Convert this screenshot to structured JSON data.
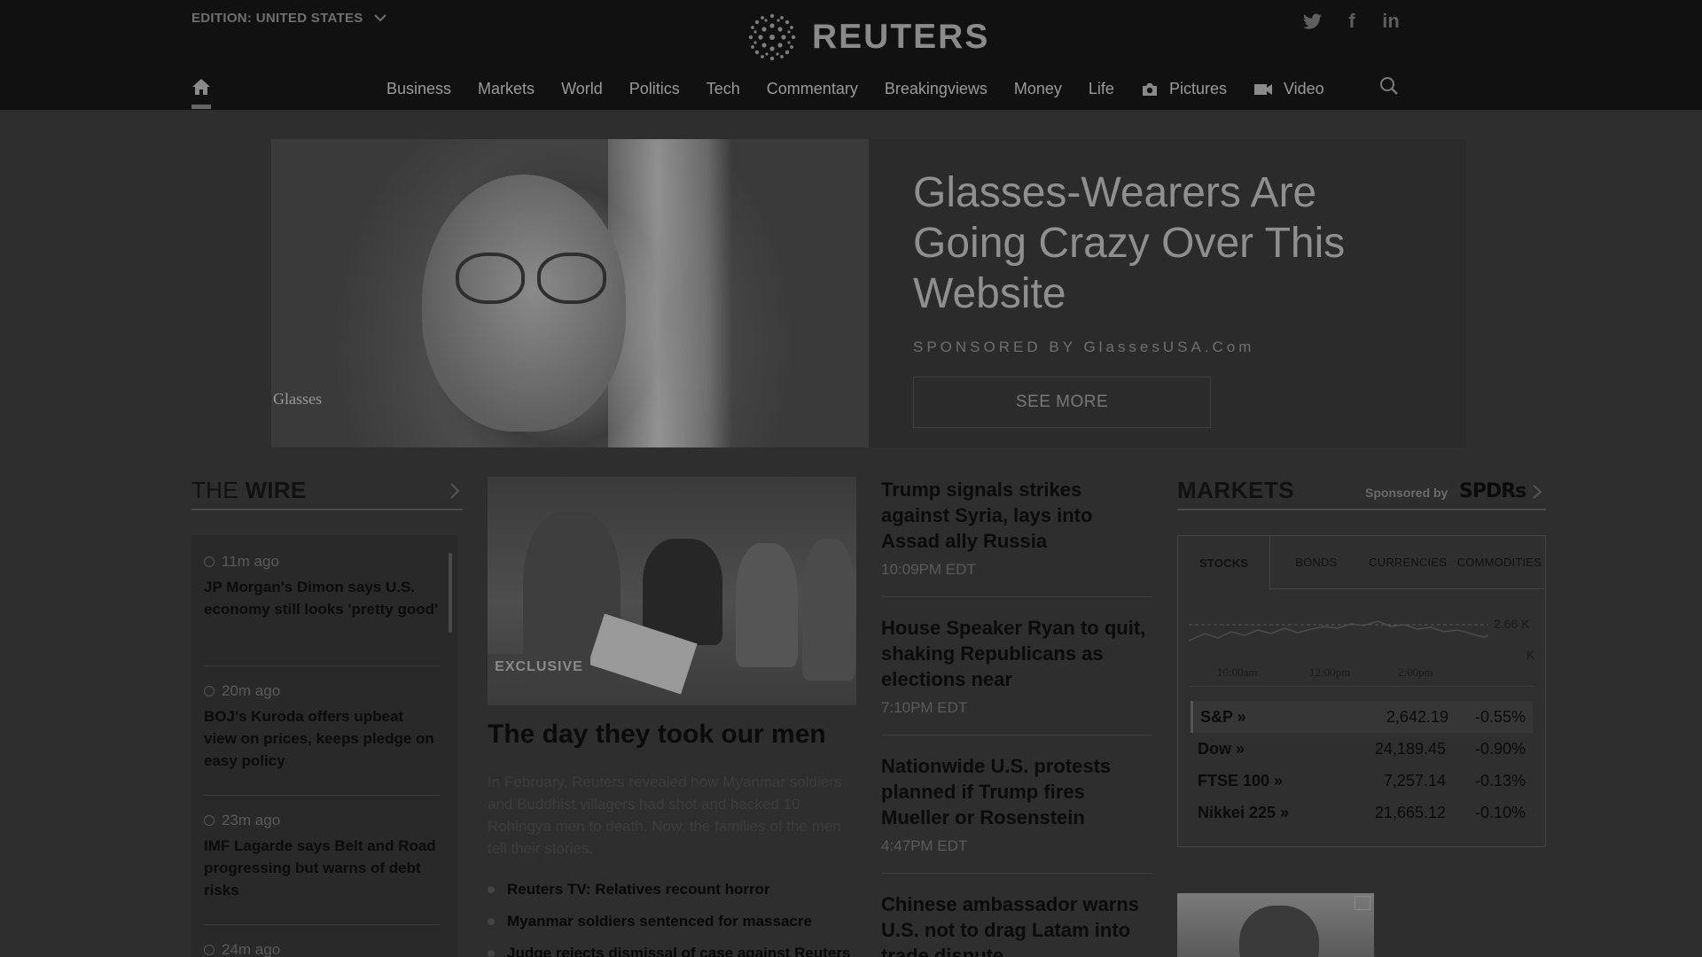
{
  "header": {
    "edition_label": "EDITION:",
    "edition_value": "UNITED STATES",
    "logo_text": "REUTERS",
    "social": [
      "twitter-icon",
      "facebook-icon",
      "linkedin-icon"
    ],
    "social_glyphs": {
      "facebook": "f",
      "linkedin": "in"
    }
  },
  "nav": {
    "items": [
      "Business",
      "Markets",
      "World",
      "Politics",
      "Tech",
      "Commentary",
      "Breakingviews",
      "Money",
      "Life",
      "Pictures",
      "Video"
    ]
  },
  "ad": {
    "brand": "Glasses",
    "title": "Glasses-Wearers Are Going Crazy Over This Website",
    "sponsor": "SPONSORED BY GlassesUSA.Com",
    "button": "SEE MORE"
  },
  "wire": {
    "title_plain": "THE ",
    "title_bold": "WIRE",
    "items": [
      {
        "time": "11m ago",
        "text": "JP Morgan's Dimon says U.S. economy still looks 'pretty good'"
      },
      {
        "time": "20m ago",
        "text": "BOJ's Kuroda offers upbeat view on prices, keeps pledge on easy policy"
      },
      {
        "time": "23m ago",
        "text": "IMF Lagarde says Belt and Road progressing but warns of debt risks"
      },
      {
        "time": "24m ago",
        "text": ""
      }
    ]
  },
  "feature": {
    "badge": "EXCLUSIVE",
    "title": "The day they took our men",
    "description": "In February, Reuters revealed how Myanmar soldiers and Buddhist villagers had shot and hacked 10 Rohingya men to death. Now, the families of the men tell their stories.",
    "bullets": [
      "Reuters TV: Relatives recount horror",
      "Myanmar soldiers sentenced for massacre",
      "Judge rejects dismissal of case against Reuters"
    ]
  },
  "headlines": [
    {
      "title": "Trump signals strikes against Syria, lays into Assad ally Russia",
      "time": "10:09PM EDT"
    },
    {
      "title": "House Speaker Ryan to quit, shaking Republicans as elections near",
      "time": "7:10PM EDT"
    },
    {
      "title": "Nationwide U.S. protests planned if Trump fires Mueller or Rosenstein",
      "time": "4:47PM EDT"
    },
    {
      "title": "Chinese ambassador warns U.S. not to drag Latam into trade dispute",
      "time": ""
    }
  ],
  "markets": {
    "title": "MARKETS",
    "sponsored_by": "Sponsored by",
    "sponsor_logo": "SPDRs",
    "tabs": [
      "STOCKS",
      "BONDS",
      "CURRENCIES",
      "COMMODITIES"
    ],
    "active_tab": "STOCKS",
    "chart": {
      "x_labels": [
        "10:00am",
        "12:00pm",
        "2:00pm"
      ],
      "y_labels": [
        "2.66 K",
        "K"
      ]
    },
    "rows": [
      {
        "name": "S&P »",
        "value": "2,642.19",
        "change": "-0.55%"
      },
      {
        "name": "Dow »",
        "value": "24,189.45",
        "change": "-0.90%"
      },
      {
        "name": "FTSE 100 »",
        "value": "7,257.14",
        "change": "-0.13%"
      },
      {
        "name": "Nikkei 225 »",
        "value": "21,665.12",
        "change": "-0.10%"
      }
    ]
  }
}
